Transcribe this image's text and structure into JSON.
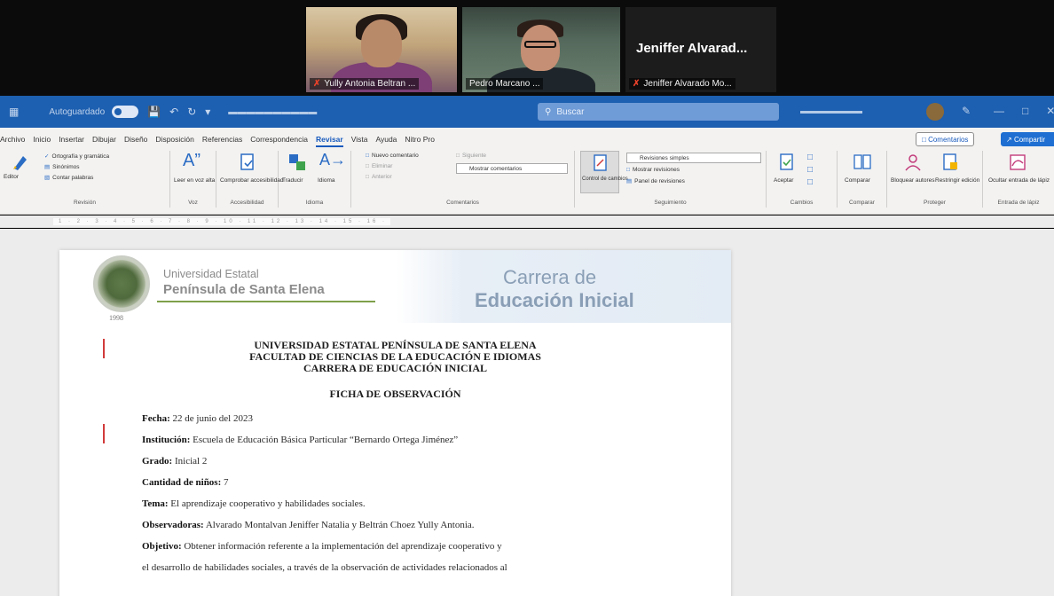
{
  "meeting": {
    "participants": [
      {
        "name": "Yully Antonia Beltran ..."
      },
      {
        "name": "Pedro Marcano ..."
      },
      {
        "name": "Jeniffer Alvarado Mo...",
        "display_name": "Jeniffer Alvarad..."
      }
    ]
  },
  "titlebar": {
    "autosave": "Autoguardado",
    "search_placeholder": "Buscar"
  },
  "ribbon": {
    "tabs": [
      "Archivo",
      "Inicio",
      "Insertar",
      "Dibujar",
      "Diseño",
      "Disposición",
      "Referencias",
      "Correspondencia",
      "Revisar",
      "Vista",
      "Ayuda",
      "Nitro Pro"
    ],
    "active_tab": "Revisar",
    "comments_button": "Comentarios",
    "share_button": "Compartir",
    "groups": {
      "revision": {
        "label": "Revisión",
        "items": [
          "Ortografía y gramática",
          "Sinónimos",
          "Contar palabras"
        ],
        "editor": "Editor"
      },
      "voz": {
        "label": "Voz",
        "item": "Leer en voz alta"
      },
      "accesibilidad": {
        "label": "Accesibilidad",
        "item": "Comprobar accesibilidad"
      },
      "idioma": {
        "label": "Idioma",
        "items": [
          "Traducir",
          "Idioma"
        ]
      },
      "comentarios": {
        "label": "Comentarios",
        "items": [
          "Nuevo comentario",
          "Eliminar",
          "Anterior",
          "Siguiente",
          "Mostrar comentarios"
        ]
      },
      "seguimiento": {
        "label": "Seguimiento",
        "items": [
          "Control de cambios",
          "Revisiones simples",
          "Mostrar revisiones",
          "Panel de revisiones"
        ]
      },
      "cambios": {
        "label": "Cambios",
        "item": "Aceptar"
      },
      "comparar": {
        "label": "Comparar",
        "item": "Comparar"
      },
      "proteger": {
        "label": "Proteger",
        "items": [
          "Bloquear autores",
          "Restringir edición"
        ]
      },
      "entrada": {
        "label": "Entrada de lápiz",
        "item": "Ocultar entrada de lápiz"
      }
    }
  },
  "document": {
    "header": {
      "uni_line1": "Universidad Estatal",
      "uni_line2": "Península de Santa Elena",
      "logo_year": "1998",
      "carrera_line1": "Carrera de",
      "carrera_line2": "Educación Inicial"
    },
    "headings": [
      "UNIVERSIDAD ESTATAL PENÍNSULA DE SANTA ELENA",
      "FACULTAD DE CIENCIAS DE LA EDUCACIÓN E IDIOMAS",
      "CARRERA DE EDUCACIÓN INICIAL"
    ],
    "form_title": "FICHA DE OBSERVACIÓN",
    "fields": [
      {
        "label": "Fecha:",
        "value": " 22 de junio del 2023"
      },
      {
        "label": "Institución:",
        "value": " Escuela de Educación Básica Particular “Bernardo Ortega Jiménez”"
      },
      {
        "label": "Grado:",
        "value": " Inicial 2"
      },
      {
        "label": "Cantidad de niños:",
        "value": " 7"
      },
      {
        "label": "Tema:",
        "value": " El aprendizaje cooperativo y habilidades sociales."
      },
      {
        "label": "Observadoras:",
        "value": " Alvarado Montalvan Jeniffer Natalia y Beltrán Choez Yully Antonia."
      },
      {
        "label": "Objetivo:",
        "value": " Obtener información referente a la implementación del aprendizaje cooperativo y"
      }
    ],
    "continuation": "el desarrollo de habilidades sociales, a través de la observación de actividades relacionados al"
  },
  "colors": {
    "word_blue": "#1d5fb0",
    "ribbon_bg": "#f3f2f1",
    "revision_mark": "#d23b3b"
  }
}
